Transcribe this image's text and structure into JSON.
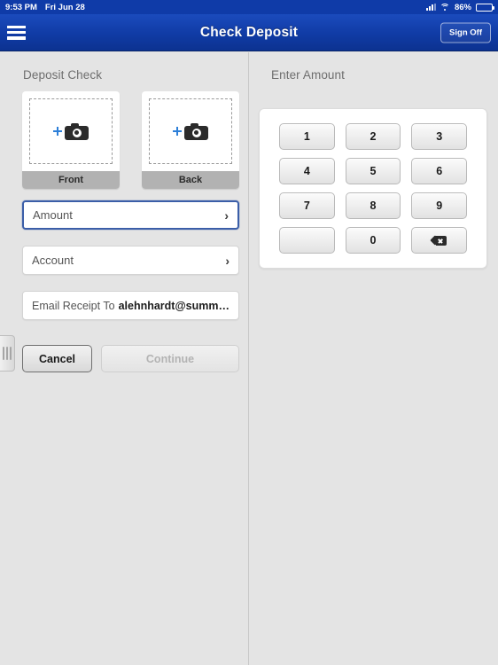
{
  "status_bar": {
    "time": "9:53 PM",
    "date": "Fri Jun 28",
    "battery_percent": "86%",
    "signal_icon": "cellular-signal-icon",
    "wifi_icon": "wifi-icon",
    "battery_icon": "battery-icon"
  },
  "nav_bar": {
    "menu_icon": "hamburger-menu-icon",
    "title": "Check Deposit",
    "sign_off_label": "Sign Off",
    "background_color": "#103ba5"
  },
  "left_panel": {
    "title": "Deposit Check",
    "capture_tiles": [
      {
        "label": "Front",
        "add_icon": "plus-icon",
        "camera_icon": "camera-icon"
      },
      {
        "label": "Back",
        "add_icon": "plus-icon",
        "camera_icon": "camera-icon"
      }
    ],
    "fields": [
      {
        "label": "Amount",
        "focused": true,
        "chevron": "›"
      },
      {
        "label": "Account",
        "focused": false,
        "chevron": "›"
      }
    ],
    "email_row": {
      "prefix": "Email Receipt To",
      "value": "alehnhardt@summitstat…"
    },
    "buttons": {
      "cancel_label": "Cancel",
      "continue_label": "Continue",
      "continue_enabled": false
    },
    "drag_handle_icon": "drag-handle-icon"
  },
  "right_panel": {
    "title": "Enter Amount",
    "keypad": {
      "keys": [
        {
          "label": "1",
          "type": "digit"
        },
        {
          "label": "2",
          "type": "digit"
        },
        {
          "label": "3",
          "type": "digit"
        },
        {
          "label": "4",
          "type": "digit"
        },
        {
          "label": "5",
          "type": "digit"
        },
        {
          "label": "6",
          "type": "digit"
        },
        {
          "label": "7",
          "type": "digit"
        },
        {
          "label": "8",
          "type": "digit"
        },
        {
          "label": "9",
          "type": "digit"
        },
        {
          "label": "",
          "type": "blank"
        },
        {
          "label": "0",
          "type": "digit"
        },
        {
          "label": "",
          "type": "backspace",
          "icon": "backspace-icon"
        }
      ]
    }
  },
  "accent_colors": {
    "nav_blue": "#103ba5",
    "focus_blue": "#3b5ea8",
    "plus_blue": "#2d7fd8",
    "page_background": "#e4e4e4"
  }
}
